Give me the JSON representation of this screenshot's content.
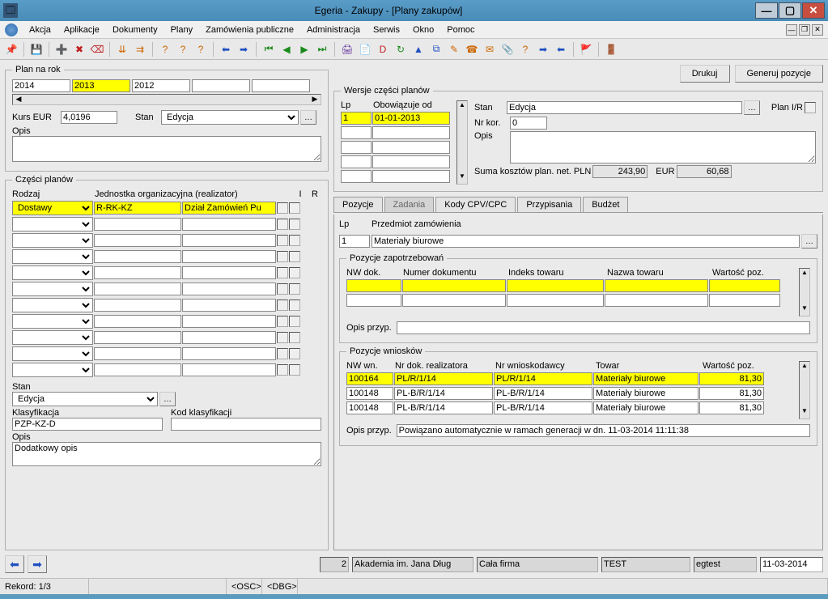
{
  "window": {
    "title": "Egeria - Zakupy - [Plany zakupów]"
  },
  "menu": [
    "Akcja",
    "Aplikacje",
    "Dokumenty",
    "Plany",
    "Zamówienia publiczne",
    "Administracja",
    "Serwis",
    "Okno",
    "Pomoc"
  ],
  "plan_na_rok": {
    "legend": "Plan na rok",
    "years": [
      "2014",
      "2013",
      "2012",
      "",
      ""
    ],
    "kurs_eur_label": "Kurs EUR",
    "kurs_eur": "4,0196",
    "stan_label": "Stan",
    "stan": "Edycja",
    "opis_label": "Opis",
    "opis": ""
  },
  "czesci": {
    "legend": "Części planów",
    "rodzaj_label": "Rodzaj",
    "jednostka_label": "Jednostka organizacyjna (realizator)",
    "i_label": "I",
    "r_label": "R",
    "rows": [
      {
        "rodzaj": "Dostawy",
        "kod": "R-RK-KZ",
        "nazwa": "Dział Zamówień Pu"
      },
      {
        "rodzaj": "",
        "kod": "",
        "nazwa": ""
      },
      {
        "rodzaj": "",
        "kod": "",
        "nazwa": ""
      },
      {
        "rodzaj": "",
        "kod": "",
        "nazwa": ""
      },
      {
        "rodzaj": "",
        "kod": "",
        "nazwa": ""
      },
      {
        "rodzaj": "",
        "kod": "",
        "nazwa": ""
      },
      {
        "rodzaj": "",
        "kod": "",
        "nazwa": ""
      },
      {
        "rodzaj": "",
        "kod": "",
        "nazwa": ""
      },
      {
        "rodzaj": "",
        "kod": "",
        "nazwa": ""
      },
      {
        "rodzaj": "",
        "kod": "",
        "nazwa": ""
      },
      {
        "rodzaj": "",
        "kod": "",
        "nazwa": ""
      }
    ],
    "stan_label": "Stan",
    "stan": "Edycja",
    "klasyfikacja_label": "Klasyfikacja",
    "klasyfikacja": "PZP-KZ-D",
    "kod_klas_label": "Kod klasyfikacji",
    "kod_klas": "",
    "opis_label": "Opis",
    "opis": "Dodatkowy opis"
  },
  "top_buttons": {
    "drukuj": "Drukuj",
    "generuj": "Generuj pozycje"
  },
  "wersje": {
    "legend": "Wersje części planów",
    "lp_label": "Lp",
    "obow_label": "Obowiązuje od",
    "rows": [
      {
        "lp": "1",
        "od": "01-01-2013"
      },
      {
        "lp": "",
        "od": ""
      },
      {
        "lp": "",
        "od": ""
      },
      {
        "lp": "",
        "od": ""
      },
      {
        "lp": "",
        "od": ""
      }
    ],
    "stan_label": "Stan",
    "stan": "Edycja",
    "plan_ir_label": "Plan I/R",
    "nr_kor_label": "Nr kor.",
    "nr_kor": "0",
    "opis_label": "Opis",
    "opis": "",
    "suma_label": "Suma kosztów plan. net. PLN",
    "suma_pln": "243,90",
    "eur_label": "EUR",
    "suma_eur": "60,68"
  },
  "tabs": [
    "Pozycje",
    "Zadania",
    "Kody CPV/CPC",
    "Przypisania",
    "Budżet"
  ],
  "zadanie": {
    "lp_label": "Lp",
    "przedmiot_label": "Przedmiot zamówienia",
    "lp": "1",
    "przedmiot": "Materiały biurowe"
  },
  "poz_zap": {
    "legend": "Pozycje zapotrzebowań",
    "headers": [
      "NW dok.",
      "Numer dokumentu",
      "Indeks towaru",
      "Nazwa towaru",
      "Wartość poz."
    ],
    "opis_label": "Opis przyp.",
    "opis": ""
  },
  "poz_wn": {
    "legend": "Pozycje wniosków",
    "headers": [
      "NW wn.",
      "Nr dok. realizatora",
      "Nr wnioskodawcy",
      "Towar",
      "Wartość poz."
    ],
    "rows": [
      {
        "c0": "100164",
        "c1": "PL/R/1/14",
        "c2": "PL/R/1/14",
        "c3": "Materiały biurowe",
        "c4": "81,30"
      },
      {
        "c0": "100148",
        "c1": "PL-B/R/1/14",
        "c2": "PL-B/R/1/14",
        "c3": "Materiały biurowe",
        "c4": "81,30"
      },
      {
        "c0": "100148",
        "c1": "PL-B/R/1/14",
        "c2": "PL-B/R/1/14",
        "c3": "Materiały biurowe",
        "c4": "81,30"
      }
    ],
    "opis_label": "Opis przyp.",
    "opis": "Powiązano automatycznie w ramach generacji w dn. 11-03-2014 11:11:38"
  },
  "nav": {
    "num": "2",
    "f1": "Akademia im. Jana Dług",
    "f2": "Cała firma",
    "f3": "TEST",
    "f4": "egtest",
    "f5": "11-03-2014"
  },
  "status": {
    "rekord": "Rekord: 1/3",
    "osc": "<OSC>",
    "dbg": "<DBG>"
  }
}
